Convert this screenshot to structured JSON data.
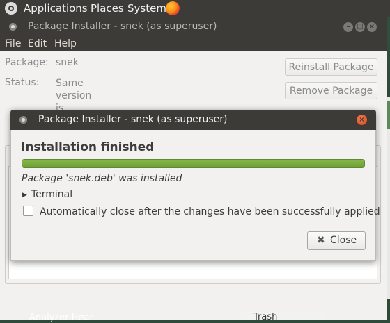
{
  "panel": {
    "menus": [
      "Applications",
      "Places",
      "System"
    ]
  },
  "window": {
    "title": "Package Installer - snek (as superuser)",
    "menus": [
      "File",
      "Edit",
      "Help"
    ],
    "package_label": "Package:",
    "package_value": "snek",
    "status_label": "Status:",
    "status_value_lines": [
      "Same",
      "version",
      "is"
    ],
    "reinstall_label": "Reinstall Package",
    "remove_label": "Remove Package"
  },
  "dialog": {
    "title": "Package Installer - snek (as superuser)",
    "heading": "Installation finished",
    "progress_fraction": 1.0,
    "message": "Package 'snek.deb' was installed",
    "expander_label": "Terminal",
    "autoclose_label": "Automatically close after the changes have been successfully applied",
    "autoclose_checked": false,
    "close_label": "Close"
  },
  "desktop": {
    "bottom_label": "Analyzer Hear",
    "trash_label": "Trash"
  },
  "icons": {
    "ubuntu": "ubuntu-logo-icon",
    "firefox": "firefox-icon",
    "window_close": "close-icon",
    "close_button": "x-icon",
    "expander": "triangle-right-icon"
  },
  "colors": {
    "titlebar": "#3c3b37",
    "progress": "#73a33b",
    "close_button_orange": "#dd4814"
  }
}
